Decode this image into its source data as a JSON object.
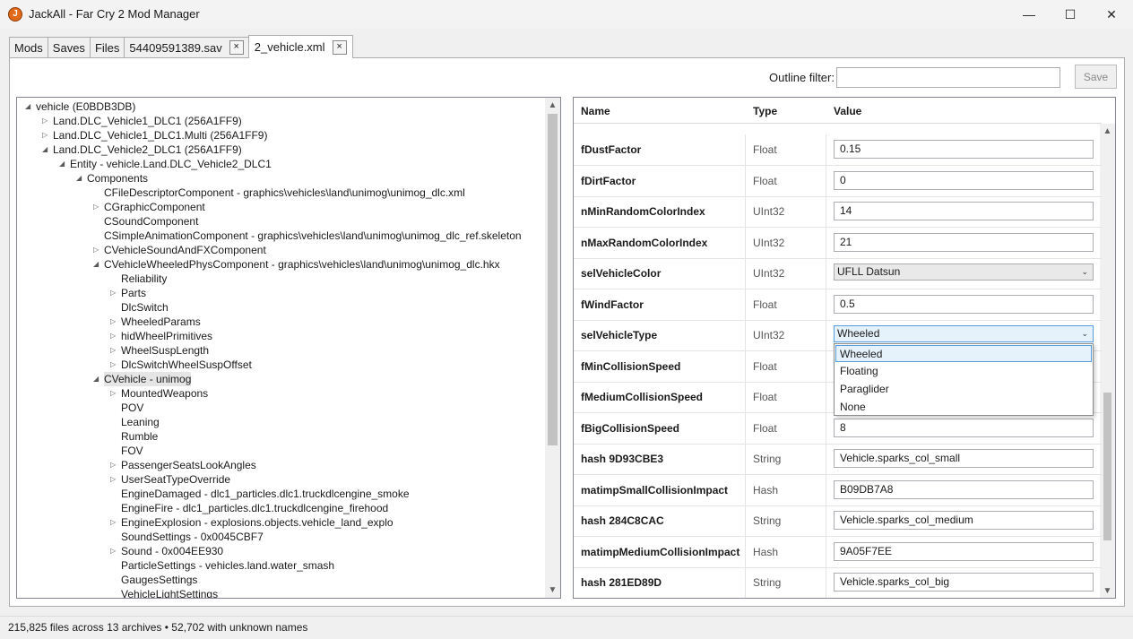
{
  "window": {
    "title": "JackAll - Far Cry 2 Mod Manager",
    "minimize": "—",
    "maximize": "☐",
    "close": "✕",
    "icon_glyph": "J"
  },
  "tabs": [
    {
      "label": "Mods",
      "closable": false,
      "active": false
    },
    {
      "label": "Saves",
      "closable": false,
      "active": false
    },
    {
      "label": "Files",
      "closable": false,
      "active": false
    },
    {
      "label": "54409591389.sav",
      "closable": true,
      "active": false
    },
    {
      "label": "2_vehicle.xml",
      "closable": true,
      "active": true
    }
  ],
  "tab_close_glyph": "×",
  "toolbar": {
    "filter_label": "Outline filter:",
    "filter_value": "",
    "save_label": "Save"
  },
  "tree": {
    "nodes": [
      {
        "label": "vehicle (E0BDB3DB)",
        "expander": "expanded",
        "level": 0
      },
      {
        "label": "Land.DLC_Vehicle1_DLC1 (256A1FF9)",
        "expander": "collapsed",
        "level": 1
      },
      {
        "label": "Land.DLC_Vehicle1_DLC1.Multi (256A1FF9)",
        "expander": "collapsed",
        "level": 1
      },
      {
        "label": "Land.DLC_Vehicle2_DLC1 (256A1FF9)",
        "expander": "expanded",
        "level": 1
      },
      {
        "label": "Entity - vehicle.Land.DLC_Vehicle2_DLC1",
        "expander": "expanded",
        "level": 2
      },
      {
        "label": "Components",
        "expander": "expanded",
        "level": 3
      },
      {
        "label": "CFileDescriptorComponent - graphics\\vehicles\\land\\unimog\\unimog_dlc.xml",
        "expander": "none",
        "level": 4
      },
      {
        "label": "CGraphicComponent",
        "expander": "collapsed",
        "level": 4
      },
      {
        "label": "CSoundComponent",
        "expander": "none",
        "level": 4
      },
      {
        "label": "CSimpleAnimationComponent - graphics\\vehicles\\land\\unimog\\unimog_dlc_ref.skeleton",
        "expander": "none",
        "level": 4
      },
      {
        "label": "CVehicleSoundAndFXComponent",
        "expander": "collapsed",
        "level": 4
      },
      {
        "label": "CVehicleWheeledPhysComponent - graphics\\vehicles\\land\\unimog\\unimog_dlc.hkx",
        "expander": "expanded",
        "level": 4
      },
      {
        "label": "Reliability",
        "expander": "none",
        "level": 5
      },
      {
        "label": "Parts",
        "expander": "collapsed",
        "level": 5
      },
      {
        "label": "DlcSwitch",
        "expander": "none",
        "level": 5
      },
      {
        "label": "WheeledParams",
        "expander": "collapsed",
        "level": 5
      },
      {
        "label": "hidWheelPrimitives",
        "expander": "collapsed",
        "level": 5
      },
      {
        "label": "WheelSuspLength",
        "expander": "collapsed",
        "level": 5
      },
      {
        "label": "DlcSwitchWheelSuspOffset",
        "expander": "collapsed",
        "level": 5
      },
      {
        "label": "CVehicle - unimog",
        "expander": "expanded",
        "level": 4,
        "selected": true
      },
      {
        "label": "MountedWeapons",
        "expander": "collapsed",
        "level": 5
      },
      {
        "label": "POV",
        "expander": "none",
        "level": 5
      },
      {
        "label": "Leaning",
        "expander": "none",
        "level": 5
      },
      {
        "label": "Rumble",
        "expander": "none",
        "level": 5
      },
      {
        "label": "FOV",
        "expander": "none",
        "level": 5
      },
      {
        "label": "PassengerSeatsLookAngles",
        "expander": "collapsed",
        "level": 5
      },
      {
        "label": "UserSeatTypeOverride",
        "expander": "collapsed",
        "level": 5
      },
      {
        "label": "EngineDamaged - dlc1_particles.dlc1.truckdlcengine_smoke",
        "expander": "none",
        "level": 5
      },
      {
        "label": "EngineFire - dlc1_particles.dlc1.truckdlcengine_firehood",
        "expander": "none",
        "level": 5
      },
      {
        "label": "EngineExplosion - explosions.objects.vehicle_land_explo",
        "expander": "collapsed",
        "level": 5
      },
      {
        "label": "SoundSettings - 0x0045CBF7",
        "expander": "none",
        "level": 5
      },
      {
        "label": "Sound - 0x004EE930",
        "expander": "collapsed",
        "level": 5
      },
      {
        "label": "ParticleSettings - vehicles.land.water_smash",
        "expander": "none",
        "level": 5
      },
      {
        "label": "GaugesSettings",
        "expander": "none",
        "level": 5
      },
      {
        "label": "VehicleLightSettings",
        "expander": "none",
        "level": 5
      }
    ]
  },
  "scroll_glyphs": {
    "up": "▲",
    "down": "▼"
  },
  "grid": {
    "headers": {
      "name": "Name",
      "type": "Type",
      "value": "Value"
    },
    "rows": [
      {
        "name": "fDustFactor",
        "type": "Float",
        "value": "0.15",
        "kind": "text"
      },
      {
        "name": "fDirtFactor",
        "type": "Float",
        "value": "0",
        "kind": "text"
      },
      {
        "name": "nMinRandomColorIndex",
        "type": "UInt32",
        "value": "14",
        "kind": "text"
      },
      {
        "name": "nMaxRandomColorIndex",
        "type": "UInt32",
        "value": "21",
        "kind": "text"
      },
      {
        "name": "selVehicleColor",
        "type": "UInt32",
        "value": "UFLL Datsun",
        "kind": "select"
      },
      {
        "name": "fWindFactor",
        "type": "Float",
        "value": "0.5",
        "kind": "text"
      },
      {
        "name": "selVehicleType",
        "type": "UInt32",
        "value": "Wheeled",
        "kind": "select",
        "open": true
      },
      {
        "name": "fMinCollisionSpeed",
        "type": "Float",
        "value": "",
        "kind": "text"
      },
      {
        "name": "fMediumCollisionSpeed",
        "type": "Float",
        "value": "",
        "kind": "text"
      },
      {
        "name": "fBigCollisionSpeed",
        "type": "Float",
        "value": "8",
        "kind": "text"
      },
      {
        "name": "hash 9D93CBE3",
        "type": "String",
        "value": "Vehicle.sparks_col_small",
        "kind": "text"
      },
      {
        "name": "matimpSmallCollisionImpact",
        "type": "Hash",
        "value": "B09DB7A8",
        "kind": "text"
      },
      {
        "name": "hash 284C8CAC",
        "type": "String",
        "value": "Vehicle.sparks_col_medium",
        "kind": "text"
      },
      {
        "name": "matimpMediumCollisionImpact",
        "type": "Hash",
        "value": "9A05F7EE",
        "kind": "text"
      },
      {
        "name": "hash 281ED89D",
        "type": "String",
        "value": "Vehicle.sparks_col_big",
        "kind": "text"
      }
    ],
    "chevron_glyph": "⌄",
    "dropdown_options": [
      "Wheeled",
      "Floating",
      "Paraglider",
      "None"
    ],
    "dropdown_selected": "Wheeled"
  },
  "status": {
    "text": "215,825 files across 13 archives  •  52,702 with unknown names"
  }
}
